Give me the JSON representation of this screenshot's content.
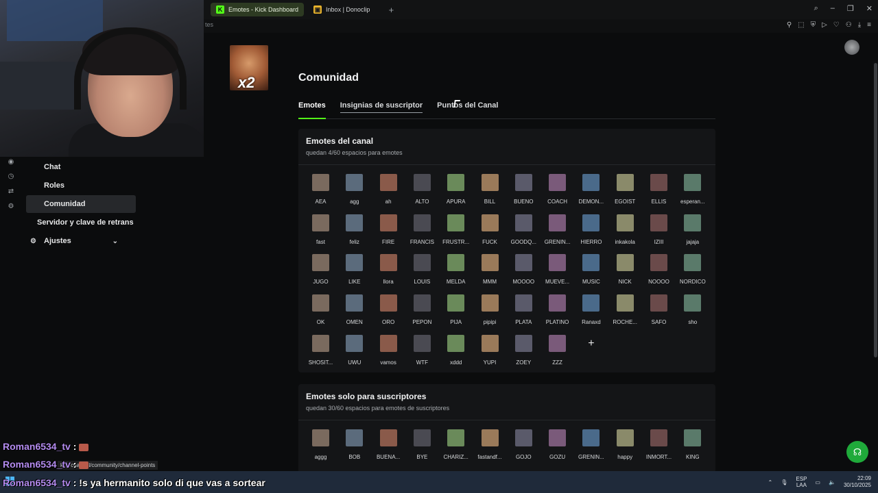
{
  "browser": {
    "tabs": [
      {
        "label": "Emotes - Kick Dashboard",
        "favicon": "kick-icon",
        "active": true
      },
      {
        "label": "Inbox | Donoclip",
        "favicon": "donoclip-icon",
        "active": false
      }
    ],
    "address_crumb": "tes",
    "status_url_prefix": "k",
    "status_url": "n/channel/community/channel-points"
  },
  "nav": {
    "items": [
      {
        "label": "Chat"
      },
      {
        "label": "Roles"
      },
      {
        "label": "Comunidad"
      },
      {
        "label": "Servidor y clave de retrans"
      },
      {
        "label": "Ajustes"
      }
    ]
  },
  "page": {
    "title": "Comunidad",
    "tabs": [
      "Emotes",
      "Insignias de suscriptor",
      "Puntos del Canal"
    ],
    "avatar_badge": "x2"
  },
  "channel_emotes": {
    "heading": "Emotes del canal",
    "subtitle": "quedan 4/60 espacios para emotes",
    "items": [
      "AEA",
      "agg",
      "ah",
      "ALTO",
      "APURA",
      "BILL",
      "BUENO",
      "COACH",
      "DEMON...",
      "EGOIST",
      "ELLIS",
      "esperan...",
      "fast",
      "feliz",
      "FIRE",
      "FRANCIS",
      "FRUSTR...",
      "FUCK",
      "GOODQ...",
      "GRENIN...",
      "HIERRO",
      "inkakola",
      "IZIII",
      "jajaja",
      "JUGO",
      "LIKE",
      "llora",
      "LOUIS",
      "MELDA",
      "MMM",
      "MOOOO",
      "MUEVE...",
      "MUSIC",
      "NICK",
      "NOOOO",
      "NORDICO",
      "OK",
      "OMEN",
      "ORO",
      "PEPON",
      "PIJA",
      "pipipi",
      "PLATA",
      "PLATINO",
      "Ranaxd",
      "ROCHE...",
      "SAFO",
      "sho",
      "SHOSIT...",
      "UWU",
      "vamos",
      "WTF",
      "xddd",
      "YUPI",
      "ZOEY",
      "ZZZ"
    ]
  },
  "sub_emotes": {
    "heading": "Emotes solo para suscriptores",
    "subtitle": "quedan 30/60 espacios para emotes de suscriptores",
    "items": [
      "aggg",
      "BOB",
      "BUENA...",
      "BYE",
      "CHARIZ...",
      "fastandf...",
      "GOJO",
      "GOZU",
      "GRENIN...",
      "happy",
      "INMORT...",
      "KING"
    ]
  },
  "chat": [
    {
      "user": "Roman6534_tv",
      "message": ""
    },
    {
      "user": "Roman6534_tv",
      "message": ""
    },
    {
      "user": "Roman6534_tv",
      "message": "!s ya hermanito solo di que vas a sortear"
    }
  ],
  "taskbar": {
    "lang_top": "ESP",
    "lang_bottom": "LAA",
    "time": "22:09",
    "date": "30/10/2025"
  },
  "colors": {
    "accent": "#53fc18",
    "help_button": "#1faa3a",
    "chat_user": "#b48cf0"
  }
}
